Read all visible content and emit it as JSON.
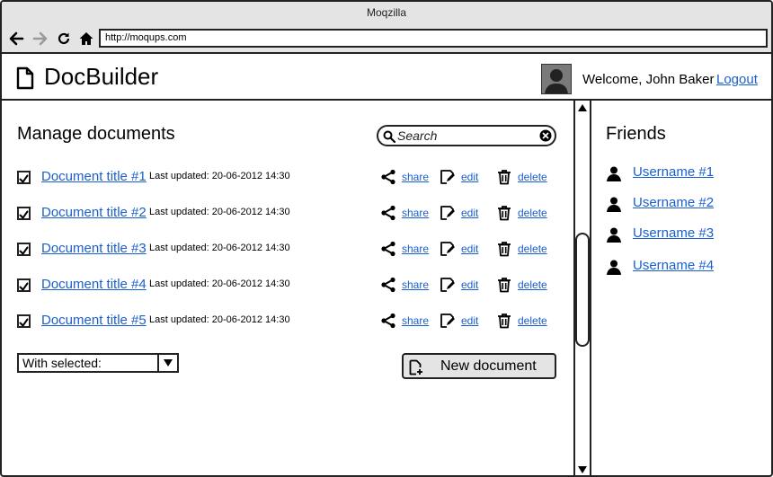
{
  "window": {
    "title": "Moqzilla"
  },
  "browser": {
    "url": "http://moqups.com",
    "icons": [
      "back-arrow-icon",
      "forward-arrow-icon",
      "reload-icon",
      "home-icon"
    ]
  },
  "header": {
    "app_title": "DocBuilder",
    "welcome": "Welcome, John Baker",
    "logout_label": "Logout"
  },
  "main": {
    "title": "Manage documents",
    "search": {
      "placeholder": "Search",
      "value": ""
    },
    "documents": [
      {
        "title": "Document title #1",
        "meta": "Last updated: 20-06-2012 14:30",
        "checked": true
      },
      {
        "title": "Document title #2",
        "meta": "Last updated: 20-06-2012 14:30",
        "checked": true
      },
      {
        "title": "Document title #3",
        "meta": "Last updated: 20-06-2012 14:30",
        "checked": true
      },
      {
        "title": "Document title #4",
        "meta": "Last updated: 20-06-2012 14:30",
        "checked": true
      },
      {
        "title": "Document title #5",
        "meta": "Last updated: 20-06-2012 14:30",
        "checked": true
      }
    ],
    "actions": {
      "share": "share",
      "edit": "edit",
      "delete": "delete"
    },
    "with_selected": "With selected:",
    "new_document_label": "New document"
  },
  "friends": {
    "title": "Friends",
    "items": [
      "Username #1",
      "Username #2",
      "Username #3",
      "Username #4"
    ]
  },
  "colors": {
    "link": "#1a5fd0",
    "chrome": "#e4e4e4",
    "border": "#222222"
  }
}
